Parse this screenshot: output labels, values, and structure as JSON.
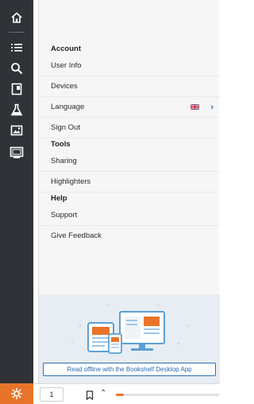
{
  "rail": {
    "icons": [
      "home-icon",
      "contents-list-icon",
      "search-icon",
      "notebook-icon",
      "flashcards-icon",
      "figures-icon",
      "reader-view-icon"
    ],
    "settings_icon": "gear-icon",
    "accent_color": "#e8742a",
    "background_color": "#2f3237"
  },
  "menu": {
    "account_heading": "Account",
    "user_info": "User Info",
    "devices": "Devices",
    "language": "Language",
    "language_flag": "uk-flag-icon",
    "sign_out": "Sign Out",
    "tools_heading": "Tools",
    "sharing": "Sharing",
    "highlighters": "Highlighters",
    "help_heading": "Help",
    "support": "Support",
    "give_feedback": "Give Feedback"
  },
  "promo": {
    "button_label": "Read offline with the Bookshelf Desktop App"
  },
  "bottombar": {
    "page_number": "1",
    "progress_fraction": 0.08
  },
  "colors": {
    "link_blue": "#2a6db5",
    "accent_orange": "#e8742a"
  }
}
